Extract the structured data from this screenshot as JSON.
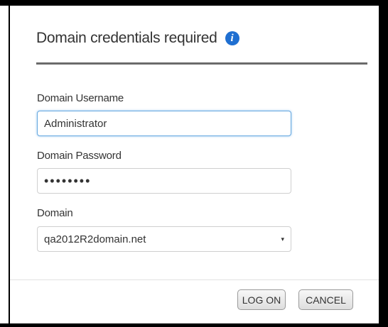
{
  "dialog": {
    "title": "Domain credentials required",
    "info_icon": "info-icon",
    "username": {
      "label": "Domain Username",
      "value": "Administrator"
    },
    "password": {
      "label": "Domain Password",
      "value": "••••••••"
    },
    "domain": {
      "label": "Domain",
      "selected": "qa2012R2domain.net",
      "caret": "▾"
    },
    "buttons": {
      "logon": "LOG ON",
      "cancel": "CANCEL"
    }
  },
  "colors": {
    "info_icon": "#1f6fd1",
    "focus_border": "#66a8df",
    "title_rule": "#6b6b6b"
  }
}
